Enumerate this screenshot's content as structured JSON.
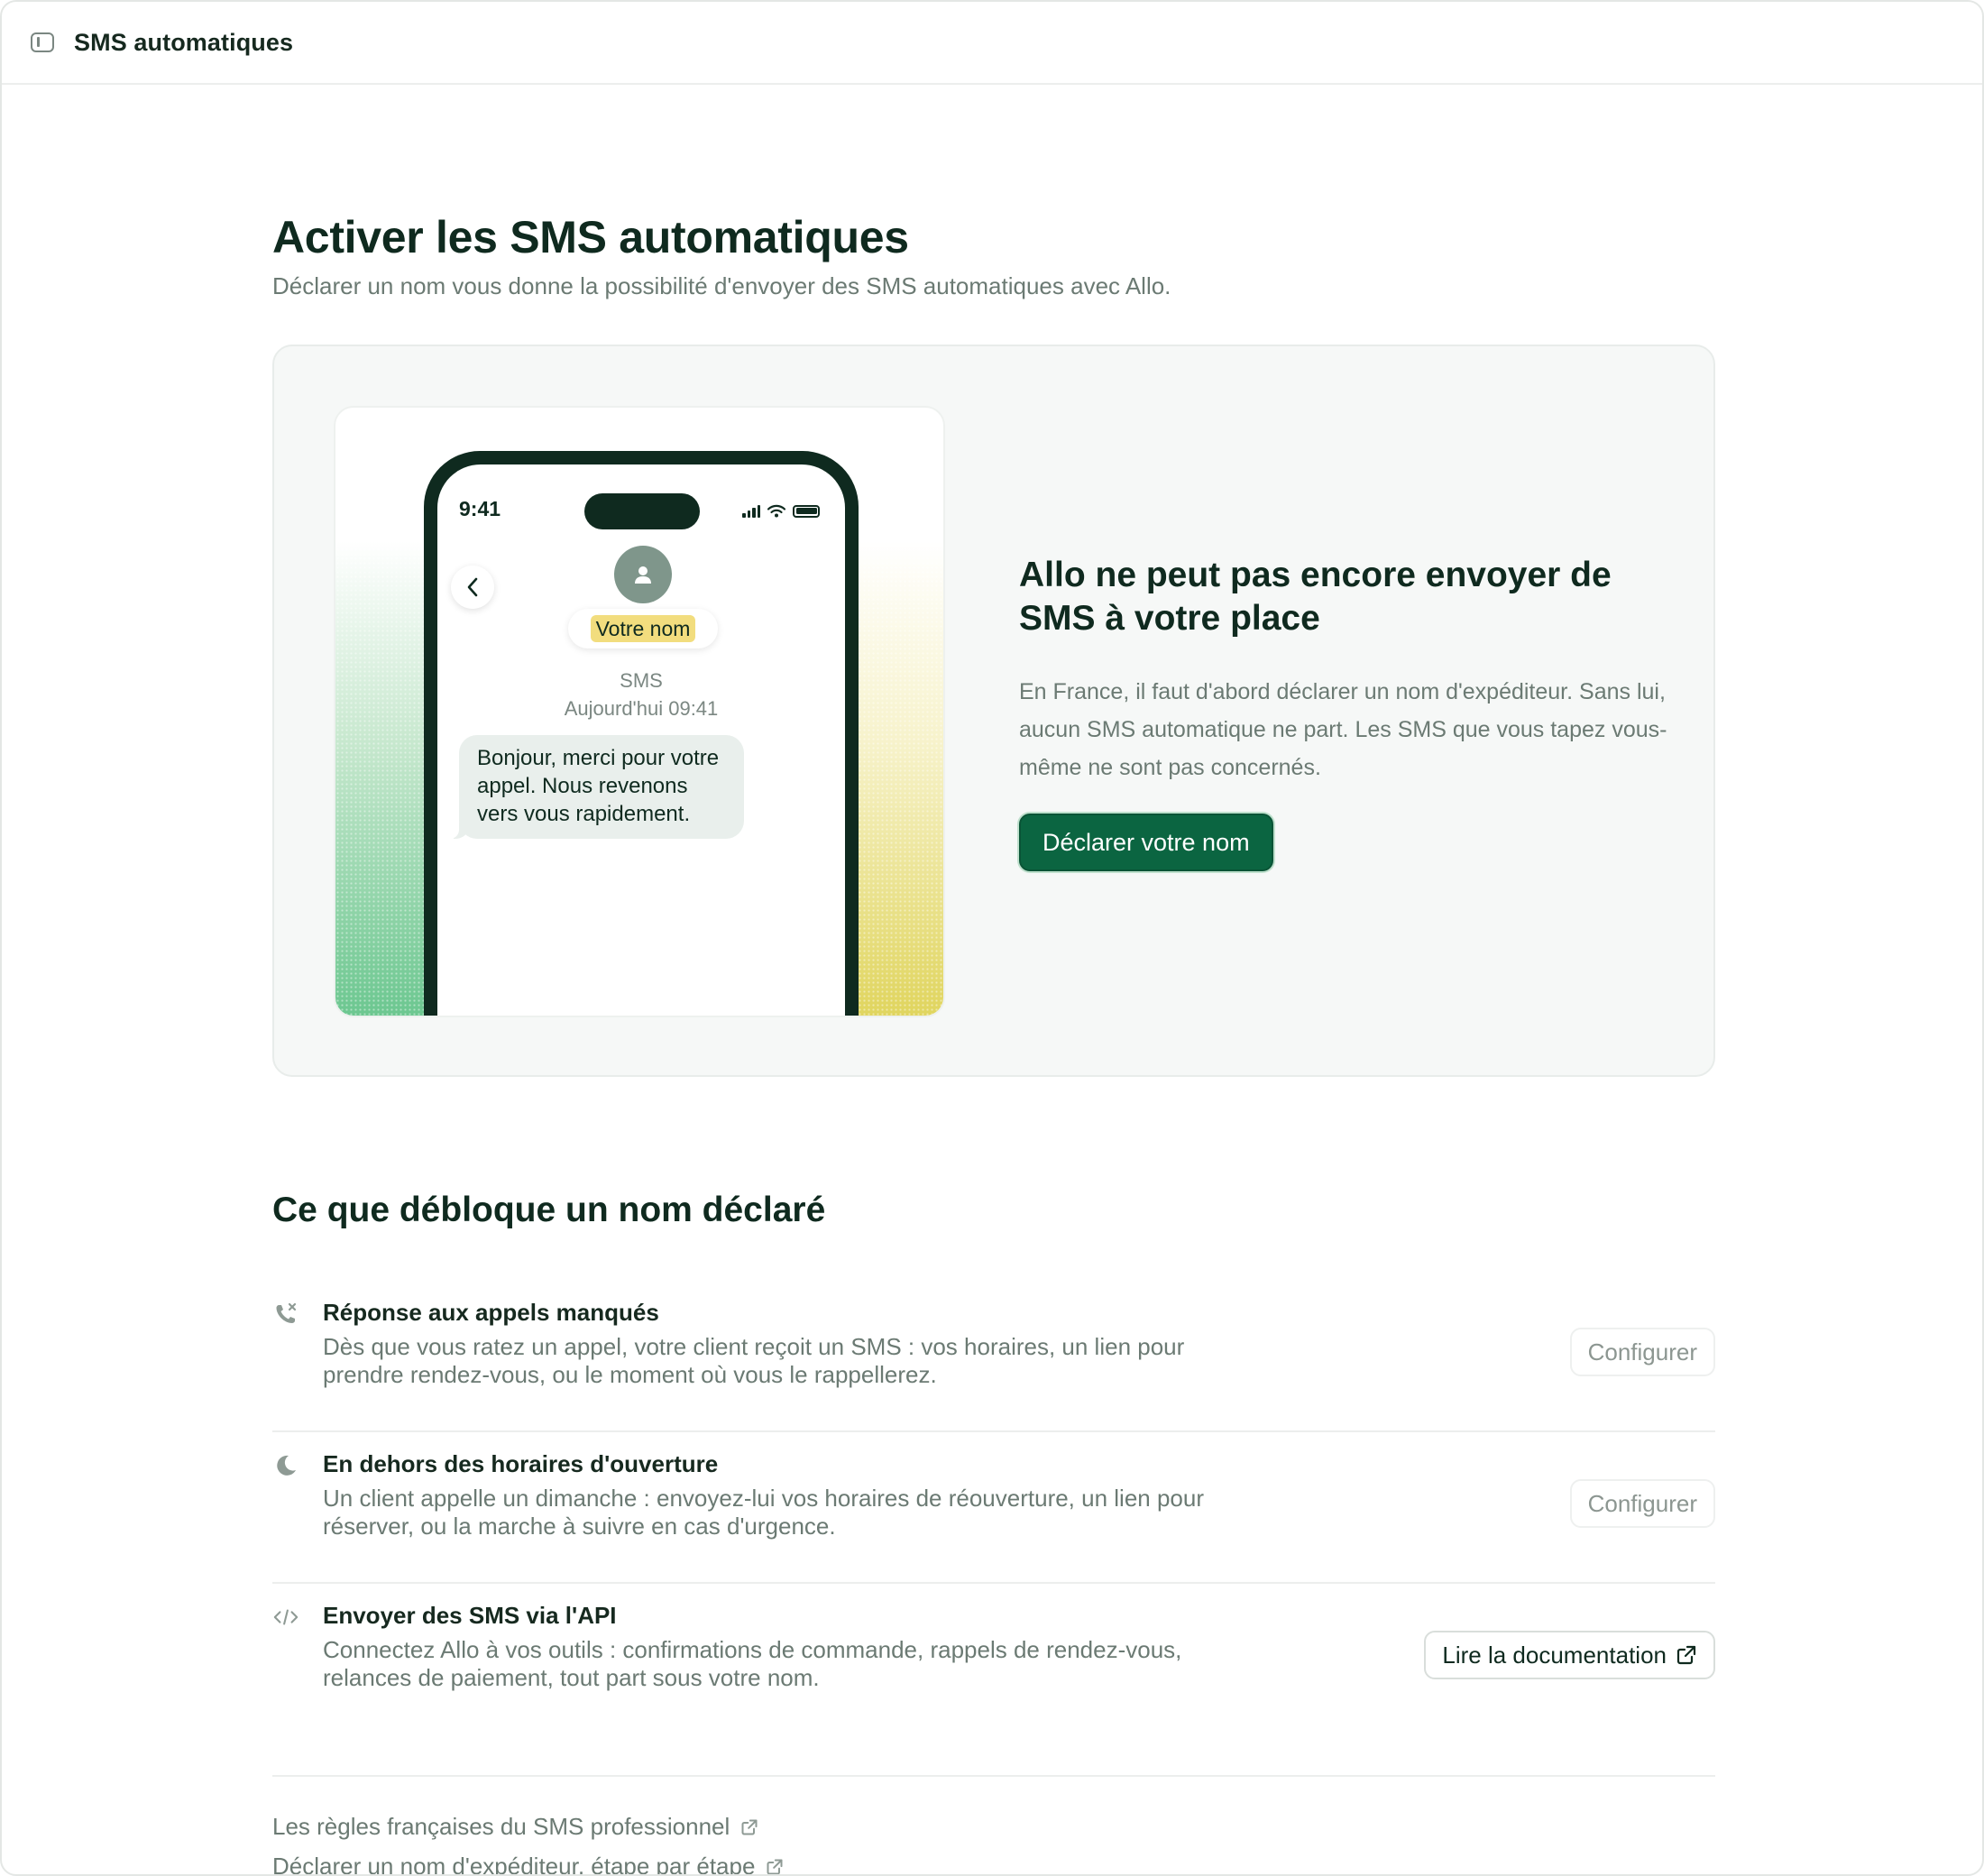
{
  "topbar": {
    "title": "SMS automatiques",
    "toggle_icon": "sidebar-toggle-icon"
  },
  "header": {
    "title": "Activer les SMS automatiques",
    "subtitle": "Déclarer un nom vous donne la possibilité d'envoyer des SMS automatiques avec Allo."
  },
  "hero": {
    "phone": {
      "time": "9:41",
      "contact_name": "Votre nom",
      "meta_channel": "SMS",
      "meta_date": "Aujourd'hui 09:41",
      "message": "Bonjour, merci pour votre appel. Nous revenons vers vous rapidement."
    },
    "title": "Allo ne peut pas encore envoyer de SMS à votre place",
    "description": "En France, il faut d'abord déclarer un nom d'expéditeur. Sans lui, aucun SMS automatique ne part. Les SMS que vous tapez vous-même ne sont pas concernés.",
    "cta_label": "Déclarer votre nom"
  },
  "unlocks": {
    "title": "Ce que débloque un nom déclaré",
    "items": [
      {
        "icon": "missed-call-icon",
        "title": "Réponse aux appels manqués",
        "description": "Dès que vous ratez un appel, votre client reçoit un SMS : vos horaires, un lien pour prendre rendez-vous, ou le moment où vous le rappellerez.",
        "action": "Configurer"
      },
      {
        "icon": "moon-icon",
        "title": "En dehors des horaires d'ouverture",
        "description": "Un client appelle un dimanche : envoyez-lui vos horaires de réouverture, un lien pour réserver, ou la marche à suivre en cas d'urgence.",
        "action": "Configurer"
      },
      {
        "icon": "code-icon",
        "title": "Envoyer des SMS via l'API",
        "description": "Connectez Allo à vos outils : confirmations de commande, rappels de rendez-vous, relances de paiement, tout part sous votre nom.",
        "action": "Lire la documentation"
      }
    ]
  },
  "footer": {
    "links": [
      "Les règles françaises du SMS professionnel",
      "Déclarer un nom d'expéditeur, étape par étape"
    ]
  },
  "colors": {
    "primary": "#0b6541",
    "text": "#0f2a1f",
    "muted": "#6b7a73",
    "highlight": "#f2dd7e"
  }
}
